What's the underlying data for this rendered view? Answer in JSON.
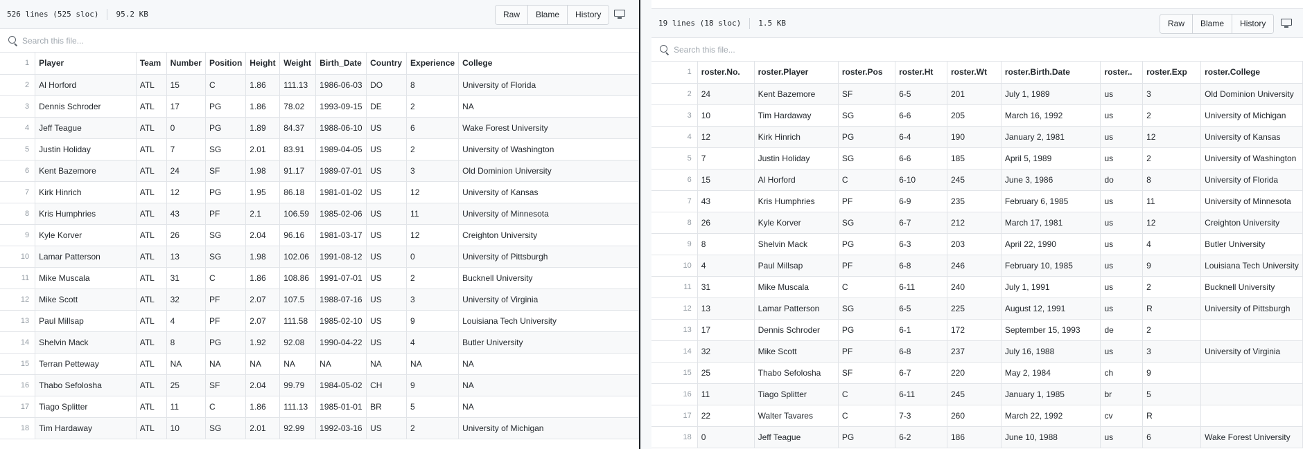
{
  "left": {
    "file_info": {
      "lines": "526 lines (525 sloc)",
      "size": "95.2 KB"
    },
    "buttons": {
      "raw": "Raw",
      "blame": "Blame",
      "history": "History"
    },
    "search": {
      "placeholder": "Search this file..."
    },
    "headers": [
      "Player",
      "Team",
      "Number",
      "Position",
      "Height",
      "Weight",
      "Birth_Date",
      "Country",
      "Experience",
      "College"
    ],
    "header_line": "1",
    "rows": [
      {
        "ln": "2",
        "cells": [
          "Al Horford",
          "ATL",
          "15",
          "C",
          "1.86",
          "111.13",
          "1986-06-03",
          "DO",
          "8",
          "University of Florida"
        ]
      },
      {
        "ln": "3",
        "cells": [
          "Dennis Schroder",
          "ATL",
          "17",
          "PG",
          "1.86",
          "78.02",
          "1993-09-15",
          "DE",
          "2",
          "NA"
        ]
      },
      {
        "ln": "4",
        "cells": [
          "Jeff Teague",
          "ATL",
          "0",
          "PG",
          "1.89",
          "84.37",
          "1988-06-10",
          "US",
          "6",
          "Wake Forest University"
        ]
      },
      {
        "ln": "5",
        "cells": [
          "Justin Holiday",
          "ATL",
          "7",
          "SG",
          "2.01",
          "83.91",
          "1989-04-05",
          "US",
          "2",
          "University of Washington"
        ]
      },
      {
        "ln": "6",
        "cells": [
          "Kent Bazemore",
          "ATL",
          "24",
          "SF",
          "1.98",
          "91.17",
          "1989-07-01",
          "US",
          "3",
          "Old Dominion University"
        ]
      },
      {
        "ln": "7",
        "cells": [
          "Kirk Hinrich",
          "ATL",
          "12",
          "PG",
          "1.95",
          "86.18",
          "1981-01-02",
          "US",
          "12",
          "University of Kansas"
        ]
      },
      {
        "ln": "8",
        "cells": [
          "Kris Humphries",
          "ATL",
          "43",
          "PF",
          "2.1",
          "106.59",
          "1985-02-06",
          "US",
          "11",
          "University of Minnesota"
        ]
      },
      {
        "ln": "9",
        "cells": [
          "Kyle Korver",
          "ATL",
          "26",
          "SG",
          "2.04",
          "96.16",
          "1981-03-17",
          "US",
          "12",
          "Creighton University"
        ]
      },
      {
        "ln": "10",
        "cells": [
          "Lamar Patterson",
          "ATL",
          "13",
          "SG",
          "1.98",
          "102.06",
          "1991-08-12",
          "US",
          "0",
          "University of Pittsburgh"
        ]
      },
      {
        "ln": "11",
        "cells": [
          "Mike Muscala",
          "ATL",
          "31",
          "C",
          "1.86",
          "108.86",
          "1991-07-01",
          "US",
          "2",
          "Bucknell University"
        ]
      },
      {
        "ln": "12",
        "cells": [
          "Mike Scott",
          "ATL",
          "32",
          "PF",
          "2.07",
          "107.5",
          "1988-07-16",
          "US",
          "3",
          "University of Virginia"
        ]
      },
      {
        "ln": "13",
        "cells": [
          "Paul Millsap",
          "ATL",
          "4",
          "PF",
          "2.07",
          "111.58",
          "1985-02-10",
          "US",
          "9",
          "Louisiana Tech University"
        ]
      },
      {
        "ln": "14",
        "cells": [
          "Shelvin Mack",
          "ATL",
          "8",
          "PG",
          "1.92",
          "92.08",
          "1990-04-22",
          "US",
          "4",
          "Butler University"
        ]
      },
      {
        "ln": "15",
        "cells": [
          "Terran Petteway",
          "ATL",
          "NA",
          "NA",
          "NA",
          "NA",
          "NA",
          "NA",
          "NA",
          "NA"
        ]
      },
      {
        "ln": "16",
        "cells": [
          "Thabo Sefolosha",
          "ATL",
          "25",
          "SF",
          "2.04",
          "99.79",
          "1984-05-02",
          "CH",
          "9",
          "NA"
        ]
      },
      {
        "ln": "17",
        "cells": [
          "Tiago Splitter",
          "ATL",
          "11",
          "C",
          "1.86",
          "111.13",
          "1985-01-01",
          "BR",
          "5",
          "NA"
        ]
      },
      {
        "ln": "18",
        "cells": [
          "Tim Hardaway",
          "ATL",
          "10",
          "SG",
          "2.01",
          "92.99",
          "1992-03-16",
          "US",
          "2",
          "University of Michigan"
        ]
      }
    ]
  },
  "right": {
    "file_info": {
      "lines": "19 lines (18 sloc)",
      "size": "1.5 KB"
    },
    "buttons": {
      "raw": "Raw",
      "blame": "Blame",
      "history": "History"
    },
    "search": {
      "placeholder": "Search this file..."
    },
    "headers": [
      "roster.No.",
      "roster.Player",
      "roster.Pos",
      "roster.Ht",
      "roster.Wt",
      "roster.Birth.Date",
      "roster..",
      "roster.Exp",
      "roster.College"
    ],
    "header_line": "1",
    "rows": [
      {
        "ln": "2",
        "cells": [
          "24",
          "Kent Bazemore",
          "SF",
          "6-5",
          "201",
          "July 1, 1989",
          "us",
          "3",
          "Old Dominion University"
        ]
      },
      {
        "ln": "3",
        "cells": [
          "10",
          "Tim Hardaway",
          "SG",
          "6-6",
          "205",
          "March 16, 1992",
          "us",
          "2",
          "University of Michigan"
        ]
      },
      {
        "ln": "4",
        "cells": [
          "12",
          "Kirk Hinrich",
          "PG",
          "6-4",
          "190",
          "January 2, 1981",
          "us",
          "12",
          "University of Kansas"
        ]
      },
      {
        "ln": "5",
        "cells": [
          "7",
          "Justin Holiday",
          "SG",
          "6-6",
          "185",
          "April 5, 1989",
          "us",
          "2",
          "University of Washington"
        ]
      },
      {
        "ln": "6",
        "cells": [
          "15",
          "Al Horford",
          "C",
          "6-10",
          "245",
          "June 3, 1986",
          "do",
          "8",
          "University of Florida"
        ]
      },
      {
        "ln": "7",
        "cells": [
          "43",
          "Kris Humphries",
          "PF",
          "6-9",
          "235",
          "February 6, 1985",
          "us",
          "11",
          "University of Minnesota"
        ]
      },
      {
        "ln": "8",
        "cells": [
          "26",
          "Kyle Korver",
          "SG",
          "6-7",
          "212",
          "March 17, 1981",
          "us",
          "12",
          "Creighton University"
        ]
      },
      {
        "ln": "9",
        "cells": [
          "8",
          "Shelvin Mack",
          "PG",
          "6-3",
          "203",
          "April 22, 1990",
          "us",
          "4",
          "Butler University"
        ]
      },
      {
        "ln": "10",
        "cells": [
          "4",
          "Paul Millsap",
          "PF",
          "6-8",
          "246",
          "February 10, 1985",
          "us",
          "9",
          "Louisiana Tech University"
        ]
      },
      {
        "ln": "11",
        "cells": [
          "31",
          "Mike Muscala",
          "C",
          "6-11",
          "240",
          "July 1, 1991",
          "us",
          "2",
          "Bucknell University"
        ]
      },
      {
        "ln": "12",
        "cells": [
          "13",
          "Lamar Patterson",
          "SG",
          "6-5",
          "225",
          "August 12, 1991",
          "us",
          "R",
          "University of Pittsburgh"
        ]
      },
      {
        "ln": "13",
        "cells": [
          "17",
          "Dennis Schroder",
          "PG",
          "6-1",
          "172",
          "September 15, 1993",
          "de",
          "2",
          ""
        ]
      },
      {
        "ln": "14",
        "cells": [
          "32",
          "Mike Scott",
          "PF",
          "6-8",
          "237",
          "July 16, 1988",
          "us",
          "3",
          "University of Virginia"
        ]
      },
      {
        "ln": "15",
        "cells": [
          "25",
          "Thabo Sefolosha",
          "SF",
          "6-7",
          "220",
          "May 2, 1984",
          "ch",
          "9",
          ""
        ]
      },
      {
        "ln": "16",
        "cells": [
          "11",
          "Tiago Splitter",
          "C",
          "6-11",
          "245",
          "January 1, 1985",
          "br",
          "5",
          ""
        ]
      },
      {
        "ln": "17",
        "cells": [
          "22",
          "Walter Tavares",
          "C",
          "7-3",
          "260",
          "March 22, 1992",
          "cv",
          "R",
          ""
        ]
      },
      {
        "ln": "18",
        "cells": [
          "0",
          "Jeff Teague",
          "PG",
          "6-2",
          "186",
          "June 10, 1988",
          "us",
          "6",
          "Wake Forest University"
        ]
      }
    ]
  }
}
